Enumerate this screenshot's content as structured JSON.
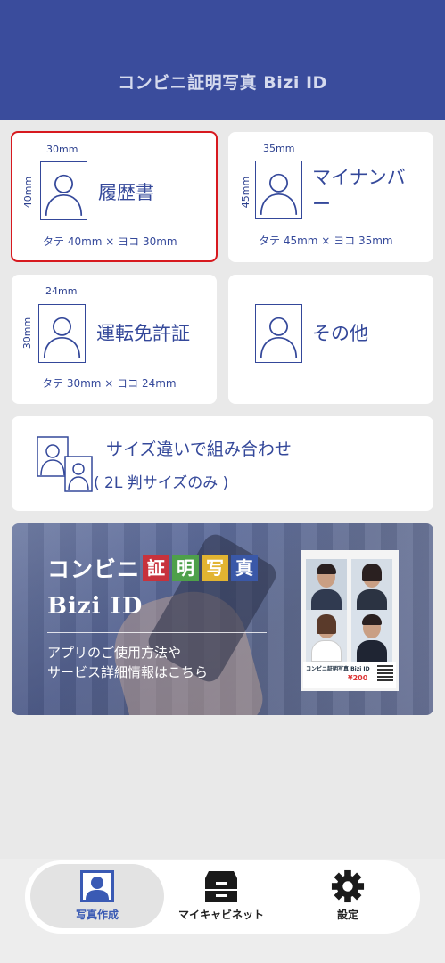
{
  "header": {
    "title": "コンビニ証明写真 Bizi ID"
  },
  "cards": [
    {
      "label": "履歴書",
      "width_text": "30mm",
      "height_text": "40mm",
      "size_text": "タテ 40mm × ヨコ 30mm",
      "selected": true
    },
    {
      "label": "マイナンバー",
      "width_text": "35mm",
      "height_text": "45mm",
      "size_text": "タテ 45mm × ヨコ 35mm"
    },
    {
      "label": "運転免許証",
      "width_text": "24mm",
      "height_text": "30mm",
      "size_text": "タテ 30mm × ヨコ 24mm"
    },
    {
      "label": "その他"
    }
  ],
  "combo": {
    "title": "サイズ違いで組み合わせ",
    "subtitle": "( 2L 判サイズのみ )"
  },
  "banner": {
    "brand_prefix": "コンビニ",
    "brand_chars": [
      "証",
      "明",
      "写",
      "真"
    ],
    "brand_colors": [
      "#c8323c",
      "#4ea04a",
      "#e2b431",
      "#3a58a8"
    ],
    "product": "Bizi ID",
    "desc_line1": "アプリのご使用方法や",
    "desc_line2": "サービス詳細情報はこちら",
    "sample_logo": "コンビニ証明写真 Bizi ID",
    "sample_price": "¥200"
  },
  "tabs": [
    {
      "label": "写真作成",
      "icon": "portrait-icon",
      "active": true
    },
    {
      "label": "マイキャビネット",
      "icon": "cabinet-icon"
    },
    {
      "label": "設定",
      "icon": "gear-icon"
    }
  ],
  "colors": {
    "header": "#3a4c9c",
    "accent": "#34489a",
    "selected_border": "#d7191f",
    "tab_active": "#3a5ab4"
  }
}
